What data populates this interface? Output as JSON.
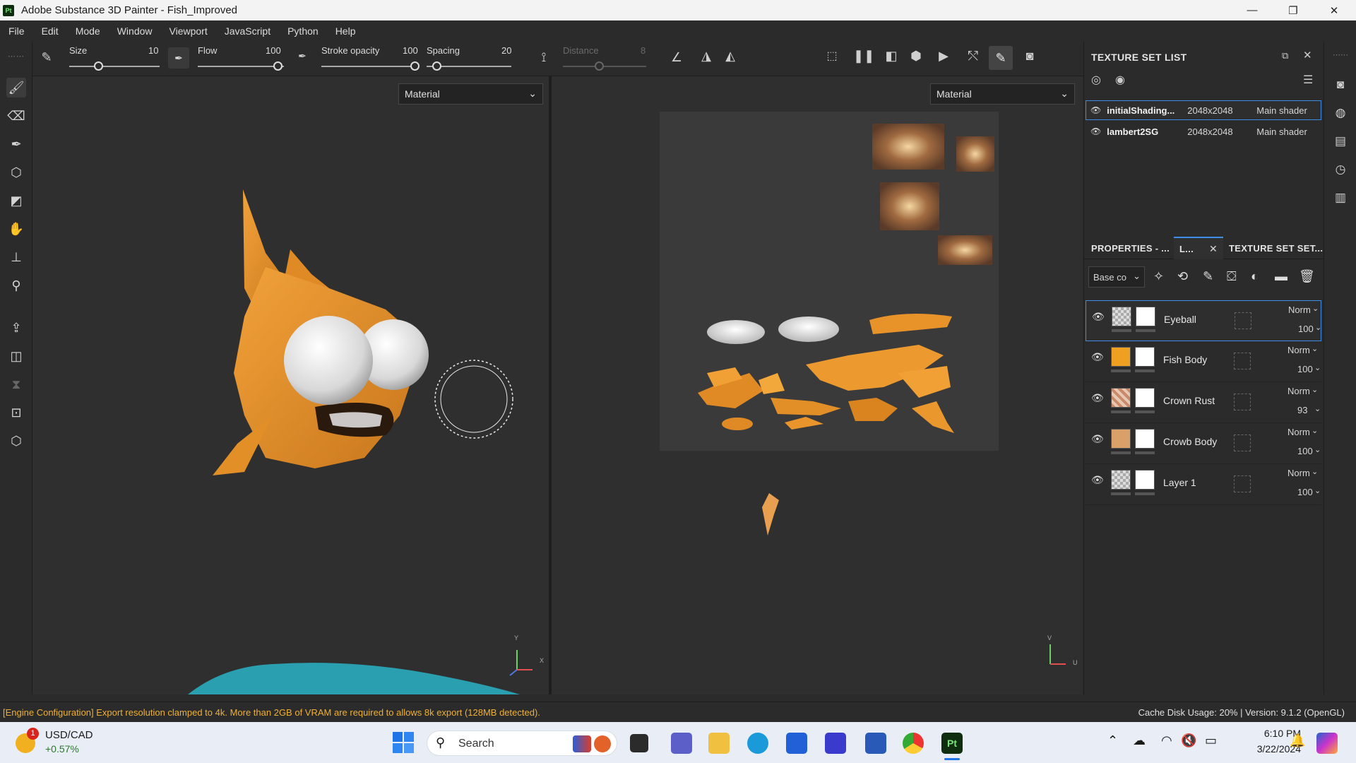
{
  "app": {
    "title": "Adobe Substance 3D Painter - Fish_Improved",
    "logo": "Pt"
  },
  "window_controls": {
    "minimize": "minimize-icon",
    "restore": "restore-icon",
    "close": "close-icon"
  },
  "menu": [
    "File",
    "Edit",
    "Mode",
    "Window",
    "Viewport",
    "JavaScript",
    "Python",
    "Help"
  ],
  "toolbar": {
    "size": {
      "label": "Size",
      "value": "10"
    },
    "flow": {
      "label": "Flow",
      "value": "100"
    },
    "stroke_opacity": {
      "label": "Stroke opacity",
      "value": "100"
    },
    "spacing": {
      "label": "Spacing",
      "value": "20"
    },
    "distance": {
      "label": "Distance",
      "value": "8"
    }
  },
  "viewport3d": {
    "channel": "Material",
    "axis_y": "Y",
    "axis_x": "X"
  },
  "viewport2d": {
    "channel": "Material",
    "axis_v": "V",
    "axis_u": "U"
  },
  "texture_set_list": {
    "title": "TEXTURE SET LIST",
    "items": [
      {
        "name": "initialShading...",
        "resolution": "2048x2048",
        "shader": "Main shader",
        "selected": true
      },
      {
        "name": "lambert2SG",
        "resolution": "2048x2048",
        "shader": "Main shader",
        "selected": false
      }
    ]
  },
  "layers_panel": {
    "tabs": [
      "PROPERTIES - ...",
      "L...",
      "TEXTURE SET SET..."
    ],
    "channel": "Base co",
    "layers": [
      {
        "name": "Eyeball",
        "blend": "Norm",
        "opacity": "100",
        "thumb": "checker",
        "selected": true
      },
      {
        "name": "Fish Body",
        "blend": "Norm",
        "opacity": "100",
        "thumb": "#f0a020",
        "selected": false
      },
      {
        "name": "Crown Rust",
        "blend": "Norm",
        "opacity": "93",
        "thumb": "rust",
        "selected": false
      },
      {
        "name": "Crowb Body",
        "blend": "Norm",
        "opacity": "100",
        "thumb": "#d9a06a",
        "selected": false
      },
      {
        "name": "Layer 1",
        "blend": "Norm",
        "opacity": "100",
        "thumb": "checker",
        "selected": false
      }
    ]
  },
  "status": {
    "message": "[Engine Configuration] Export resolution clamped to 4k. More than 2GB of VRAM are required to allows 8k export (128MB detected).",
    "cache": "Cache Disk Usage:  20% | Version: 9.1.2 (OpenGL)"
  },
  "taskbar": {
    "ticker": "USD/CAD",
    "change": "+0.57%",
    "badge": "1",
    "search": "Search",
    "time": "6:10 PM",
    "date": "3/22/2024"
  },
  "colors": {
    "accent": "#3d8ee8",
    "fish": "#e8922a",
    "status_msg": "#f0b030"
  }
}
